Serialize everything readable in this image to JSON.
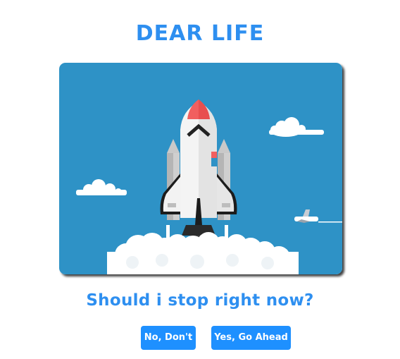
{
  "page": {
    "title": "DEAR LIFE",
    "question": "Should i stop right now?"
  },
  "illustration": {
    "description_icon": "rocket-launch-illustration"
  },
  "buttons": {
    "no_label": "No, Don't",
    "yes_label": "Yes, Go Ahead"
  },
  "colors": {
    "accent": "#2e8ff0",
    "sky": "#2e92c6",
    "button_bg": "#1e90ff",
    "flame": "#f15f5f"
  }
}
